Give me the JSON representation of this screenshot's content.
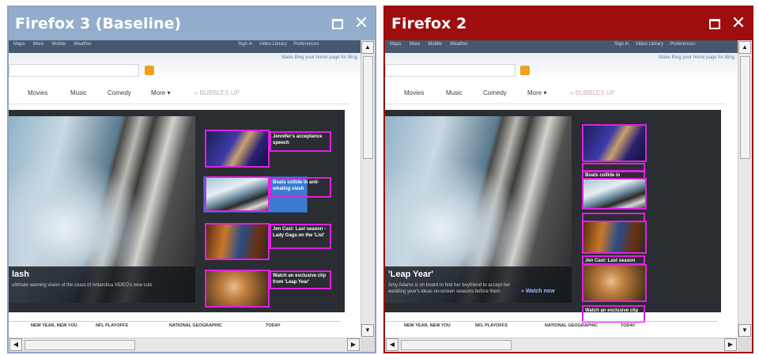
{
  "windows": {
    "left": {
      "title": "Firefox 3 (Baseline)",
      "accent": "#94adcc",
      "site": {
        "topnav_left": [
          "Maps",
          "More",
          "Mobile",
          "Weather"
        ],
        "topnav_right": [
          "Sign in",
          "Video Library",
          "Preferences"
        ],
        "search_hint": "Make Bing your home page for Bing",
        "tabs": [
          "Movies",
          "Music",
          "Comedy",
          "More ▾",
          "»  BUBBLES UP"
        ],
        "caption_title": "lash",
        "caption_desc": "ultimate warning vision of the coast of Antarctica ViDEO's new cuts",
        "thumbs": [
          {
            "caption": "Jennifer's acceptance speech"
          },
          {
            "caption": "Boats collide in anti-whaling clash"
          },
          {
            "caption": "Jen Cast: Last season - Lady Gaga on the 'List'"
          },
          {
            "caption": "Watch an exclusive clip from 'Leap Year'"
          }
        ],
        "bottom_tabs": [
          "NEW YEAR, NEW YOU",
          "NFL PLAYOFFS",
          "NATIONAL GEOGRAPHIC",
          "TODAY"
        ]
      }
    },
    "right": {
      "title": "Firefox 2",
      "accent": "#9e0e0e",
      "site": {
        "topnav_left": [
          "Maps",
          "More",
          "Mobile",
          "Weather"
        ],
        "topnav_right": [
          "Sign in",
          "Video Library",
          "Preferences"
        ],
        "search_hint": "Make Bing your home page for Bing",
        "tabs": [
          "Movies",
          "Music",
          "Comedy",
          "More ▾",
          "»  BUBBLES UP"
        ],
        "caption_title": "'Leap Year'",
        "caption_desc": "Amy Adams is on board to find her boyfriend to accept her wedding year's ideas on-screen seasons before them",
        "watch_link": "»  Watch now",
        "thumbs": [
          {
            "caption": ""
          },
          {
            "caption": "Boats collide in"
          },
          {
            "caption": ""
          },
          {
            "caption": "Jen Cast: Last season"
          },
          {
            "caption": "Watch an exclusive clip from 'Leap Year'"
          }
        ],
        "bottom_tabs": [
          "NEW YEAR, NEW YOU",
          "NFL PLAYOFFS",
          "NATIONAL GEOGRAPHIC",
          "TODAY"
        ]
      }
    }
  },
  "icons": {
    "maximize": "maximize-icon",
    "close": "close-icon",
    "search": "search-icon"
  },
  "glyphs": {
    "close": "✕",
    "up": "▲",
    "down": "▼",
    "left": "◀",
    "right": "▶"
  }
}
